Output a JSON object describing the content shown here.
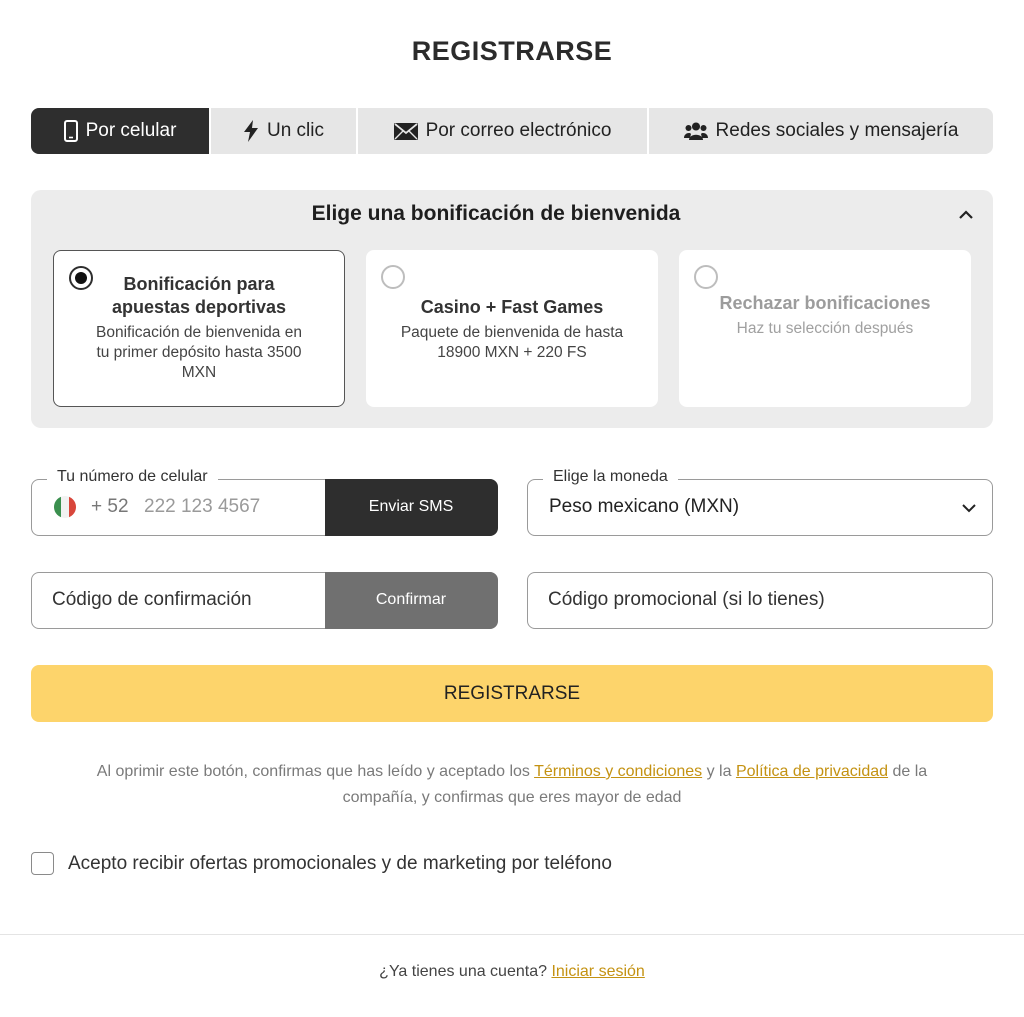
{
  "page": {
    "title": "REGISTRARSE"
  },
  "tabs": [
    {
      "label": "Por celular",
      "icon": "phone-icon",
      "active": true
    },
    {
      "label": "Un clic",
      "icon": "lightning-icon",
      "active": false
    },
    {
      "label": "Por correo electrónico",
      "icon": "envelope-icon",
      "active": false
    },
    {
      "label": "Redes sociales y mensajería",
      "icon": "users-icon",
      "active": false
    }
  ],
  "bonus": {
    "title": "Elige una bonificación de bienvenida",
    "options": [
      {
        "name": "Bonificación para apuestas deportivas",
        "description": "Bonificación de bienvenida en tu primer depósito hasta 3500 MXN",
        "selected": true
      },
      {
        "name": "Casino + Fast Games",
        "description": "Paquete de bienvenida de hasta 18900 MXN + 220 FS",
        "selected": false
      },
      {
        "name": "Rechazar bonificaciones",
        "description": "Haz tu selección después",
        "selected": false
      }
    ]
  },
  "phone": {
    "legend": "Tu número de celular",
    "country_code": "+ 52",
    "placeholder": "222 123 4567",
    "value": "",
    "send_button": "Enviar SMS",
    "flag_icon": "mexico-flag-icon"
  },
  "currency": {
    "legend": "Elige la moneda",
    "selected": "Peso mexicano (MXN)"
  },
  "confirmation": {
    "placeholder": "Código de confirmación",
    "button": "Confirmar"
  },
  "promo": {
    "placeholder": "Código promocional (si lo tienes)"
  },
  "register_button": "REGISTRARSE",
  "terms": {
    "prefix": "Al oprimir este botón, confirmas que has leído y aceptado los",
    "terms_link": "Términos y condiciones",
    "middle": "y la",
    "privacy_link": "Política de privacidad",
    "suffix": "de la compañía, y confirmas que eres mayor de edad"
  },
  "marketing": {
    "label": "Acepto recibir ofertas promocionales y de marketing por teléfono",
    "checked": false
  },
  "footer": {
    "question": "¿Ya tienes una cuenta?",
    "login_link": "Iniciar sesión"
  },
  "colors": {
    "accent": "#fdd46b",
    "link": "#c49212",
    "dark": "#2e2e2e",
    "panel": "#ececec"
  }
}
